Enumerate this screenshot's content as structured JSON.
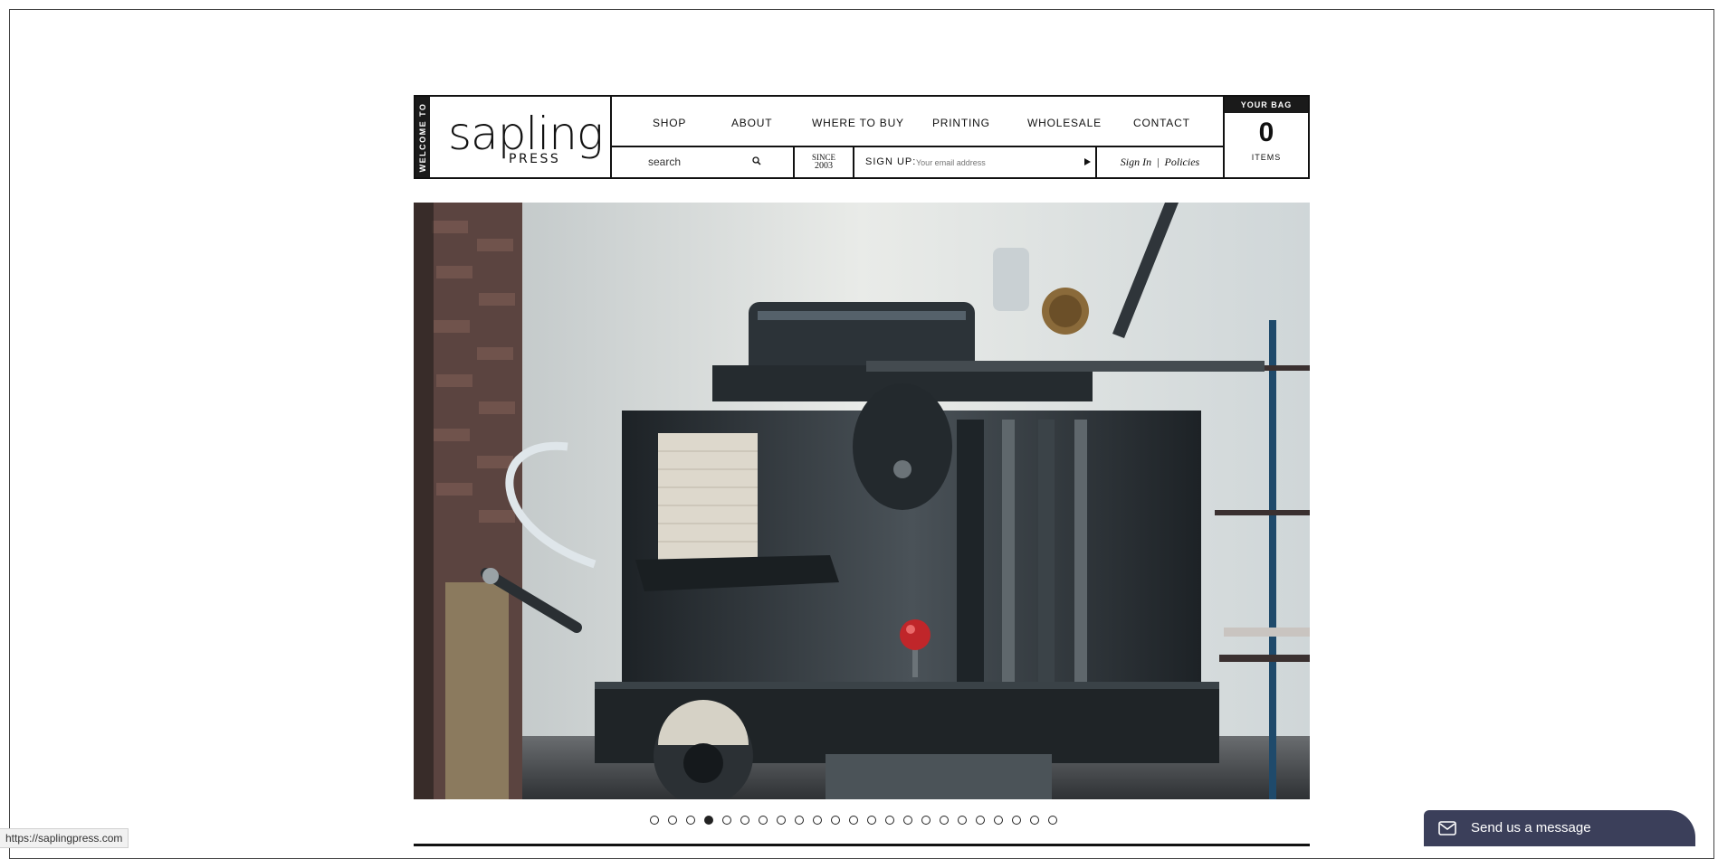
{
  "header": {
    "welcome": "WELCOME TO",
    "logo": {
      "word": "sapling",
      "sub": "PRESS"
    },
    "nav": [
      {
        "label": "SHOP"
      },
      {
        "label": "ABOUT"
      },
      {
        "label": "WHERE TO BUY"
      },
      {
        "label": "PRINTING"
      },
      {
        "label": "WHOLESALE"
      },
      {
        "label": "CONTACT"
      }
    ],
    "search": {
      "value": "search"
    },
    "since": {
      "top": "SINCE",
      "year": "2003"
    },
    "signup": {
      "label": "SIGN UP:",
      "placeholder": "Your email address"
    },
    "account": {
      "sign_in": "Sign In",
      "separator": "|",
      "policies": "Policies"
    },
    "bag": {
      "title": "YOUR BAG",
      "count": "0",
      "items_label": "ITEMS"
    }
  },
  "carousel": {
    "slide_count": 23,
    "active_index": 3
  },
  "status_bar": {
    "url": "https://saplingpress.com"
  },
  "chat": {
    "label": "Send us a message"
  },
  "colors": {
    "chat_bg": "#3b3f5a",
    "dark": "#1a1a1a"
  }
}
